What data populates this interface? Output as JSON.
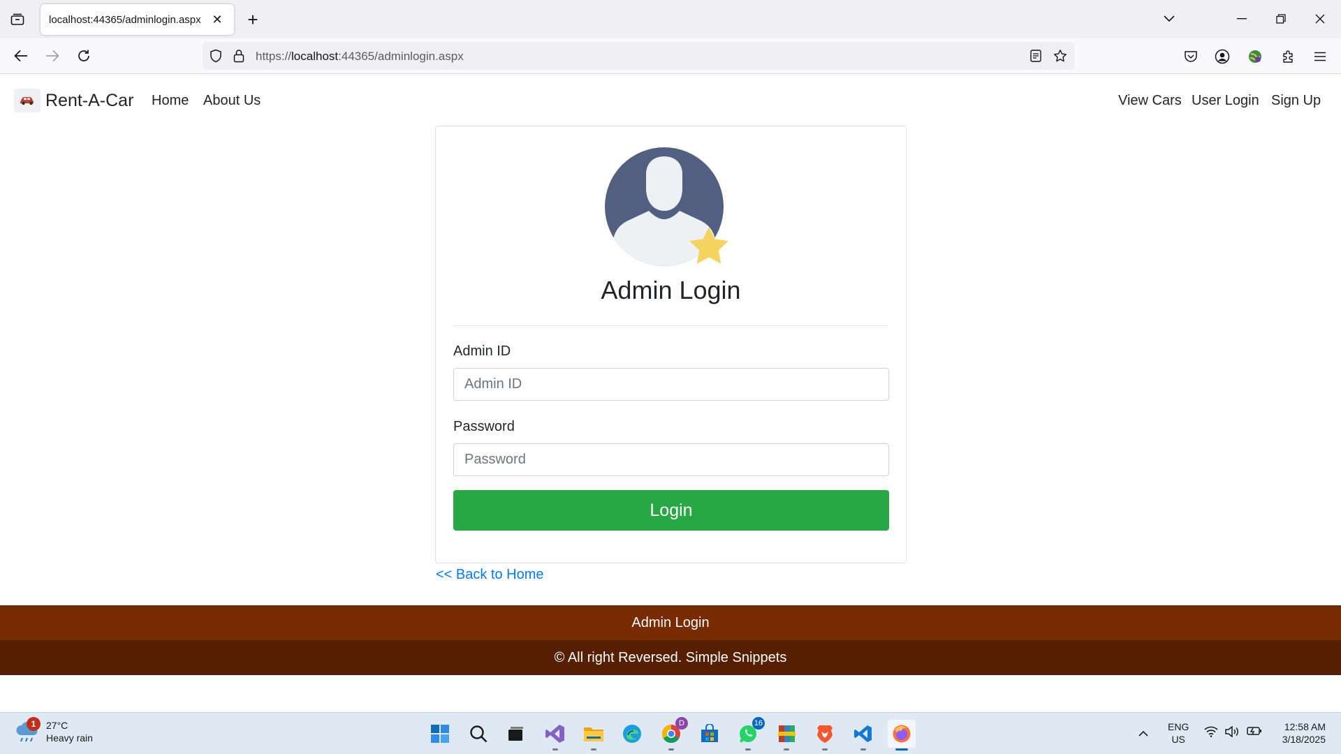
{
  "browser": {
    "tab_title": "localhost:44365/adminlogin.aspx",
    "tab_close": "✕",
    "new_tab": "+",
    "url_prefix": "https://",
    "url_host": "localhost",
    "url_rest": ":44365/adminlogin.aspx"
  },
  "site": {
    "brand": "Rent-A-Car",
    "nav_left": [
      "Home",
      "About Us"
    ],
    "nav_right": [
      "View Cars",
      "User Login",
      "Sign Up"
    ]
  },
  "login": {
    "title": "Admin Login",
    "admin_id_label": "Admin ID",
    "admin_id_placeholder": "Admin ID",
    "admin_id_value": "",
    "password_label": "Password",
    "password_placeholder": "Password",
    "password_value": "",
    "button": "Login",
    "back_link": "<< Back to Home"
  },
  "footer": {
    "title": "Admin Login",
    "copyright": "© All right Reversed. Simple Snippets"
  },
  "taskbar": {
    "weather_temp": "27°C",
    "weather_desc": "Heavy rain",
    "weather_badge": "1",
    "whatsapp_badge": "16",
    "lang_top": "ENG",
    "lang_bottom": "US",
    "time": "12:58 AM",
    "date": "3/18/2025"
  },
  "colors": {
    "login_button": "#28a745",
    "footer_top": "#782a00",
    "footer_bottom": "#561f01",
    "link": "#007bff"
  }
}
